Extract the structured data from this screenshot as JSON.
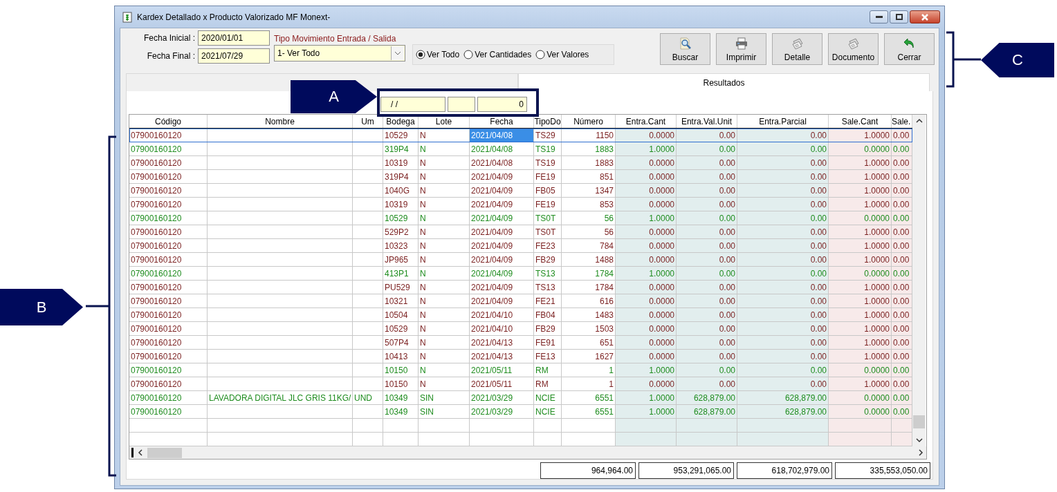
{
  "window": {
    "title": "Kardex Detallado x Producto Valorizado MF Monext-"
  },
  "filters": {
    "fecha_inicial": {
      "label": "Fecha Inicial :",
      "value": "2020/01/01"
    },
    "fecha_final": {
      "label": "Fecha Final :",
      "value": "2021/07/29"
    },
    "tipo_movimiento": {
      "label": "Tipo Movimiento  Entrada / Salida",
      "value": "1- Ver Todo"
    }
  },
  "view_options": [
    {
      "label": "Ver Todo",
      "selected": true
    },
    {
      "label": "Ver Cantidades",
      "selected": false
    },
    {
      "label": "Ver Valores",
      "selected": false
    }
  ],
  "toolbar": [
    {
      "label": "Buscar",
      "kind": "search"
    },
    {
      "label": "Imprimir",
      "kind": "print"
    },
    {
      "label": "Detalle",
      "kind": "papers"
    },
    {
      "label": "Documento",
      "kind": "papers"
    },
    {
      "label": "Cerrar",
      "kind": "back"
    }
  ],
  "tabs": [
    {
      "selected": false
    },
    {
      "label": "Resultados",
      "selected": true
    }
  ],
  "quick_filter": {
    "date": "/ /",
    "number": "0"
  },
  "table": {
    "columns": [
      {
        "label": "Código"
      },
      {
        "label": "Nombre"
      },
      {
        "label": "Um"
      },
      {
        "label": "Bodega"
      },
      {
        "label": "Lote"
      },
      {
        "label": "Fecha"
      },
      {
        "label": "TipoDo"
      },
      {
        "label": "Número"
      },
      {
        "label": "Entra.Cant",
        "kind": "entrada"
      },
      {
        "label": "Entra.Val.Unit",
        "kind": "entrada"
      },
      {
        "label": "Entra.Parcial",
        "kind": "entrada"
      },
      {
        "label": "Sale.Cant",
        "kind": "salida"
      },
      {
        "label": "Sale.",
        "kind": "salida"
      }
    ],
    "rows": [
      {
        "color": "#7a1f1f",
        "selected": true,
        "codigo": "07900160120",
        "bodega": "10529",
        "lote": "N",
        "fecha": "2021/04/08",
        "tipo": "TS29",
        "numero": "1150",
        "entra_cant": "0.0000",
        "entra_val": "0.00",
        "entra_parcial": "0.00",
        "sale_cant": "1.0000",
        "sale_col": "0.00"
      },
      {
        "color": "#1e8c1e",
        "selected": false,
        "codigo": "07900160120",
        "bodega": "319P4",
        "lote": "N",
        "fecha": "2021/04/08",
        "tipo": "TS19",
        "numero": "1883",
        "entra_cant": "1.0000",
        "entra_val": "0.00",
        "entra_parcial": "0.00",
        "sale_cant": "0.0000",
        "sale_col": "0.00"
      },
      {
        "color": "#7a1f1f",
        "selected": false,
        "codigo": "07900160120",
        "bodega": "10319",
        "lote": "N",
        "fecha": "2021/04/08",
        "tipo": "TS19",
        "numero": "1883",
        "entra_cant": "0.0000",
        "entra_val": "0.00",
        "entra_parcial": "0.00",
        "sale_cant": "1.0000",
        "sale_col": "0.00"
      },
      {
        "color": "#7a1f1f",
        "selected": false,
        "codigo": "07900160120",
        "bodega": "319P4",
        "lote": "N",
        "fecha": "2021/04/09",
        "tipo": "FE19",
        "numero": "851",
        "entra_cant": "0.0000",
        "entra_val": "0.00",
        "entra_parcial": "0.00",
        "sale_cant": "1.0000",
        "sale_col": "0.00"
      },
      {
        "color": "#7a1f1f",
        "selected": false,
        "codigo": "07900160120",
        "bodega": "1040G",
        "lote": "N",
        "fecha": "2021/04/09",
        "tipo": "FB05",
        "numero": "1347",
        "entra_cant": "0.0000",
        "entra_val": "0.00",
        "entra_parcial": "0.00",
        "sale_cant": "1.0000",
        "sale_col": "0.00"
      },
      {
        "color": "#7a1f1f",
        "selected": false,
        "codigo": "07900160120",
        "bodega": "10319",
        "lote": "N",
        "fecha": "2021/04/09",
        "tipo": "FE19",
        "numero": "853",
        "entra_cant": "0.0000",
        "entra_val": "0.00",
        "entra_parcial": "0.00",
        "sale_cant": "1.0000",
        "sale_col": "0.00"
      },
      {
        "color": "#1e8c1e",
        "selected": false,
        "codigo": "07900160120",
        "bodega": "10529",
        "lote": "N",
        "fecha": "2021/04/09",
        "tipo": "TS0T",
        "numero": "56",
        "entra_cant": "1.0000",
        "entra_val": "0.00",
        "entra_parcial": "0.00",
        "sale_cant": "0.0000",
        "sale_col": "0.00"
      },
      {
        "color": "#7a1f1f",
        "selected": false,
        "codigo": "07900160120",
        "bodega": "529P2",
        "lote": "N",
        "fecha": "2021/04/09",
        "tipo": "TS0T",
        "numero": "56",
        "entra_cant": "0.0000",
        "entra_val": "0.00",
        "entra_parcial": "0.00",
        "sale_cant": "1.0000",
        "sale_col": "0.00"
      },
      {
        "color": "#7a1f1f",
        "selected": false,
        "codigo": "07900160120",
        "bodega": "10323",
        "lote": "N",
        "fecha": "2021/04/09",
        "tipo": "FE23",
        "numero": "784",
        "entra_cant": "0.0000",
        "entra_val": "0.00",
        "entra_parcial": "0.00",
        "sale_cant": "1.0000",
        "sale_col": "0.00"
      },
      {
        "color": "#7a1f1f",
        "selected": false,
        "codigo": "07900160120",
        "bodega": "JP965",
        "lote": "N",
        "fecha": "2021/04/09",
        "tipo": "FB29",
        "numero": "1488",
        "entra_cant": "0.0000",
        "entra_val": "0.00",
        "entra_parcial": "0.00",
        "sale_cant": "1.0000",
        "sale_col": "0.00"
      },
      {
        "color": "#1e8c1e",
        "selected": false,
        "codigo": "07900160120",
        "bodega": "413P1",
        "lote": "N",
        "fecha": "2021/04/09",
        "tipo": "TS13",
        "numero": "1784",
        "entra_cant": "1.0000",
        "entra_val": "0.00",
        "entra_parcial": "0.00",
        "sale_cant": "0.0000",
        "sale_col": "0.00"
      },
      {
        "color": "#7a1f1f",
        "selected": false,
        "codigo": "07900160120",
        "bodega": "PU529",
        "lote": "N",
        "fecha": "2021/04/09",
        "tipo": "TS13",
        "numero": "1784",
        "entra_cant": "0.0000",
        "entra_val": "0.00",
        "entra_parcial": "0.00",
        "sale_cant": "1.0000",
        "sale_col": "0.00"
      },
      {
        "color": "#7a1f1f",
        "selected": false,
        "codigo": "07900160120",
        "bodega": "10321",
        "lote": "N",
        "fecha": "2021/04/09",
        "tipo": "FE21",
        "numero": "616",
        "entra_cant": "0.0000",
        "entra_val": "0.00",
        "entra_parcial": "0.00",
        "sale_cant": "1.0000",
        "sale_col": "0.00"
      },
      {
        "color": "#7a1f1f",
        "selected": false,
        "codigo": "07900160120",
        "bodega": "10504",
        "lote": "N",
        "fecha": "2021/04/10",
        "tipo": "FB04",
        "numero": "1483",
        "entra_cant": "0.0000",
        "entra_val": "0.00",
        "entra_parcial": "0.00",
        "sale_cant": "1.0000",
        "sale_col": "0.00"
      },
      {
        "color": "#7a1f1f",
        "selected": false,
        "codigo": "07900160120",
        "bodega": "10529",
        "lote": "N",
        "fecha": "2021/04/10",
        "tipo": "FB29",
        "numero": "1503",
        "entra_cant": "0.0000",
        "entra_val": "0.00",
        "entra_parcial": "0.00",
        "sale_cant": "1.0000",
        "sale_col": "0.00"
      },
      {
        "color": "#7a1f1f",
        "selected": false,
        "codigo": "07900160120",
        "bodega": "507P4",
        "lote": "N",
        "fecha": "2021/04/13",
        "tipo": "FE91",
        "numero": "651",
        "entra_cant": "0.0000",
        "entra_val": "0.00",
        "entra_parcial": "0.00",
        "sale_cant": "1.0000",
        "sale_col": "0.00"
      },
      {
        "color": "#7a1f1f",
        "selected": false,
        "codigo": "07900160120",
        "bodega": "10413",
        "lote": "N",
        "fecha": "2021/04/13",
        "tipo": "FE13",
        "numero": "1627",
        "entra_cant": "0.0000",
        "entra_val": "0.00",
        "entra_parcial": "0.00",
        "sale_cant": "1.0000",
        "sale_col": "0.00"
      },
      {
        "color": "#1e8c1e",
        "selected": false,
        "codigo": "07900160120",
        "bodega": "10150",
        "lote": "N",
        "fecha": "2021/05/11",
        "tipo": "RM",
        "numero": "1",
        "entra_cant": "1.0000",
        "entra_val": "0.00",
        "entra_parcial": "0.00",
        "sale_cant": "0.0000",
        "sale_col": "0.00"
      },
      {
        "color": "#7a1f1f",
        "selected": false,
        "codigo": "07900160120",
        "bodega": "10150",
        "lote": "N",
        "fecha": "2021/05/11",
        "tipo": "RM",
        "numero": "1",
        "entra_cant": "0.0000",
        "entra_val": "0.00",
        "entra_parcial": "0.00",
        "sale_cant": "1.0000",
        "sale_col": "0.00"
      },
      {
        "color": "#1e8c1e",
        "selected": false,
        "codigo": "07900160120",
        "nombre": "LAVADORA DIGITAL JLC GRIS 11KG/",
        "um": "UND",
        "bodega": "10349",
        "lote": "SIN",
        "fecha": "2021/03/29",
        "tipo": "NCIE",
        "numero": "6551",
        "entra_cant": "1.0000",
        "entra_val": "628,879.00",
        "entra_parcial": "628,879.00",
        "sale_cant": "0.0000",
        "sale_col": "0.00"
      },
      {
        "color": "#1e8c1e",
        "selected": false,
        "codigo": "07900160120",
        "bodega": "10349",
        "lote": "SIN",
        "fecha": "2021/03/29",
        "tipo": "NCIE",
        "numero": "6551",
        "entra_cant": "1.0000",
        "entra_val": "628,879.00",
        "entra_parcial": "628,879.00",
        "sale_cant": "0.0000",
        "sale_col": "0.00"
      }
    ]
  },
  "totals": [
    "964,964.00",
    "953,291,065.00",
    "618,702,979.00",
    "335,553,050.00"
  ],
  "annotations": [
    {
      "label": "A"
    },
    {
      "label": "B"
    },
    {
      "label": "C"
    }
  ]
}
